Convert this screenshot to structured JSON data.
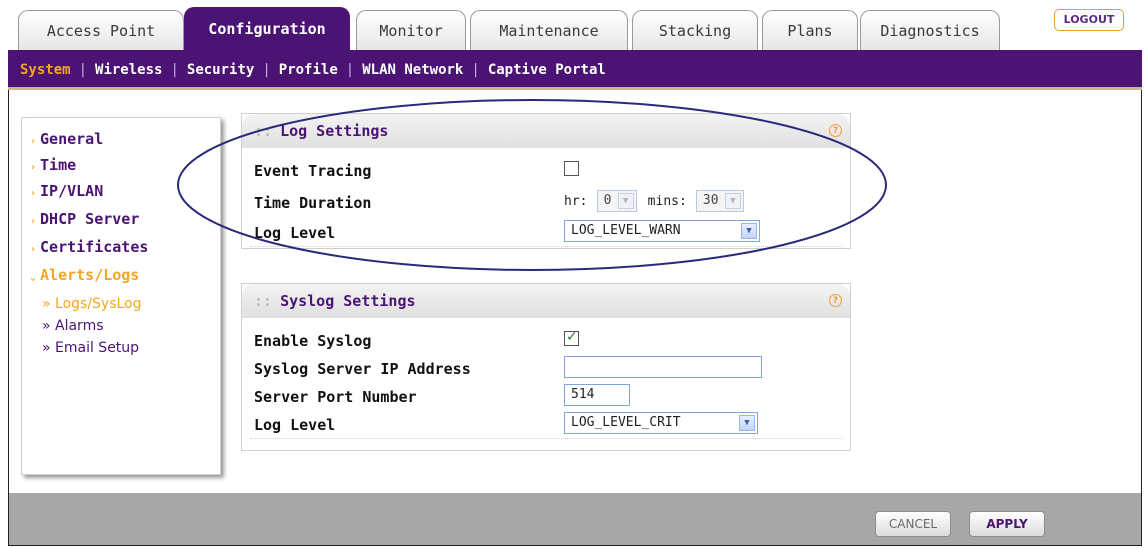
{
  "tabs": [
    {
      "label": "Access Point"
    },
    {
      "label": "Configuration",
      "active": true
    },
    {
      "label": "Monitor"
    },
    {
      "label": "Maintenance"
    },
    {
      "label": "Stacking"
    },
    {
      "label": "Plans"
    },
    {
      "label": "Diagnostics"
    }
  ],
  "logout_label": "LOGOUT",
  "subnav": [
    {
      "label": "System",
      "active": true
    },
    {
      "label": "Wireless"
    },
    {
      "label": "Security"
    },
    {
      "label": "Profile"
    },
    {
      "label": "WLAN Network"
    },
    {
      "label": "Captive Portal"
    }
  ],
  "sidebar": {
    "items": [
      {
        "label": "General"
      },
      {
        "label": "Time"
      },
      {
        "label": "IP/VLAN"
      },
      {
        "label": "DHCP Server"
      },
      {
        "label": "Certificates"
      },
      {
        "label": "Alerts/Logs",
        "open": true
      }
    ],
    "subitems": [
      {
        "label": "» Logs/SysLog",
        "active": true
      },
      {
        "label": "» Alarms"
      },
      {
        "label": "» Email Setup"
      }
    ]
  },
  "log_settings": {
    "title": "Log Settings",
    "help_icon": "?",
    "event_tracing_label": "Event Tracing",
    "event_tracing_checked": false,
    "time_duration_label": "Time Duration",
    "hr_label": "hr:",
    "hr_value": "0",
    "mins_label": "mins:",
    "mins_value": "30",
    "log_level_label": "Log Level",
    "log_level_value": "LOG_LEVEL_WARN"
  },
  "syslog_settings": {
    "title": "Syslog Settings",
    "help_icon": "?",
    "enable_label": "Enable Syslog",
    "enable_checked": true,
    "server_ip_label": "Syslog Server IP Address",
    "server_ip_value": "",
    "server_port_label": "Server Port Number",
    "server_port_value": "514",
    "log_level_label": "Log Level",
    "log_level_value": "LOG_LEVEL_CRIT"
  },
  "footer": {
    "cancel_label": "CANCEL",
    "apply_label": "APPLY"
  },
  "colors": {
    "brand_purple": "#4b1474",
    "accent_orange": "#f5a623",
    "annotation_ellipse": "#2a2a7a"
  }
}
